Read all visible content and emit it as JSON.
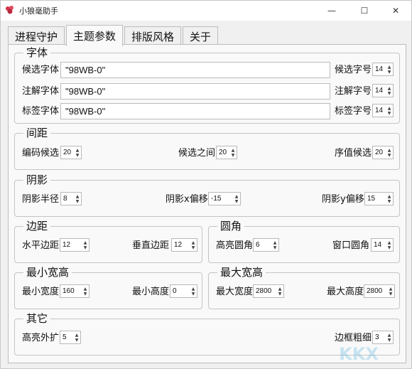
{
  "window": {
    "title": "小狼毫助手",
    "btn_min": "—",
    "btn_max": "☐",
    "btn_close": "✕"
  },
  "tabs": [
    "进程守护",
    "主题参数",
    "排版风格",
    "关于"
  ],
  "font": {
    "title": "字体",
    "candidate_label": "候选字体",
    "candidate_value": "\"98WB-0\"",
    "candidate_size_label": "候选字号",
    "candidate_size": "14",
    "comment_label": "注解字体",
    "comment_value": "\"98WB-0\"",
    "comment_size_label": "注解字号",
    "comment_size": "14",
    "label_label": "标签字体",
    "label_value": "\"98WB-0\"",
    "label_size_label": "标签字号",
    "label_size": "14"
  },
  "spacing": {
    "title": "间距",
    "code_cand_label": "编码候选",
    "code_cand": "20",
    "between_label": "候选之间",
    "between": "20",
    "index_label": "序值候选",
    "index": "20"
  },
  "shadow": {
    "title": "阴影",
    "radius_label": "阴影半径",
    "radius": "8",
    "xoff_label": "阴影x偏移",
    "xoff": "-15",
    "yoff_label": "阴影y偏移",
    "yoff": "15"
  },
  "margin": {
    "title": "边距",
    "h_label": "水平边距",
    "h": "12",
    "v_label": "垂直边距",
    "v": "12"
  },
  "corner": {
    "title": "圆角",
    "hl_label": "高亮圆角",
    "hl": "6",
    "win_label": "窗口圆角",
    "win": "14"
  },
  "min_size": {
    "title": "最小宽高",
    "w_label": "最小宽度",
    "w": "160",
    "h_label": "最小高度",
    "h": "0"
  },
  "max_size": {
    "title": "最大宽高",
    "w_label": "最大宽度",
    "w": "2800",
    "h_label": "最大高度",
    "h": "2800"
  },
  "other": {
    "title": "其它",
    "expand_label": "高亮外扩",
    "expand": "5",
    "border_label": "边框粗细",
    "border": "3"
  },
  "colors": {
    "accent": "#0078d4",
    "icon_red": "#d0344a"
  }
}
